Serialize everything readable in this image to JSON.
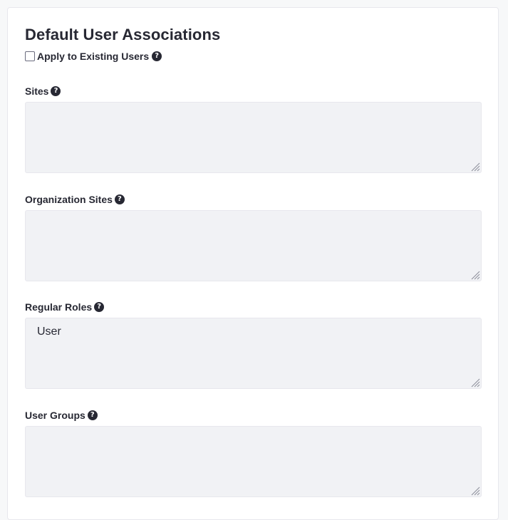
{
  "section": {
    "title": "Default User Associations",
    "apply_existing": {
      "label": "Apply to Existing Users",
      "checked": false
    }
  },
  "fields": [
    {
      "label": "Sites",
      "value": ""
    },
    {
      "label": "Organization Sites",
      "value": ""
    },
    {
      "label": "Regular Roles",
      "value": "User"
    },
    {
      "label": "User Groups",
      "value": ""
    }
  ],
  "icons": {
    "help": "question-circle-icon",
    "resize": "resize-handle-icon"
  },
  "colors": {
    "text": "#272833",
    "textarea_bg": "#f1f2f5",
    "border": "#e7e7ed"
  }
}
